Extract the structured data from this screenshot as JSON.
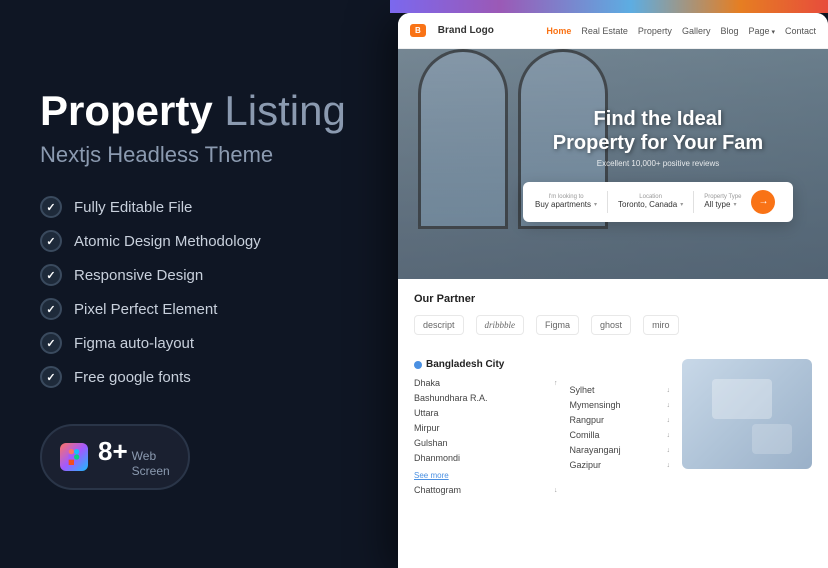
{
  "left": {
    "title_bold": "Property",
    "title_light": " Listing",
    "subtitle": "Nextjs Headless Theme",
    "features": [
      "Fully Editable File",
      "Atomic Design Methodology",
      "Responsive Design",
      "Pixel Perfect Element",
      "Figma auto-layout",
      "Free google fonts"
    ],
    "badge": {
      "number": "8+",
      "label_line1": "Web",
      "label_line2": "Screen"
    }
  },
  "browser": {
    "brand_box": "B",
    "brand_name": "Brand Logo",
    "nav_links": [
      {
        "label": "Home",
        "active": true
      },
      {
        "label": "Real Estate"
      },
      {
        "label": "Property"
      },
      {
        "label": "Gallery"
      },
      {
        "label": "Blog"
      },
      {
        "label": "Page",
        "has_arrow": true
      },
      {
        "label": "Contact"
      }
    ],
    "hero": {
      "title": "Find the Ideal\nProperty for Your Fam",
      "subtitle": "Excellent 10,000+ positive reviews",
      "search": {
        "field1_label": "I'm looking to",
        "field1_value": "Buy apartments",
        "field2_label": "Location",
        "field2_value": "Toronto, Canada",
        "field3_label": "Property Type",
        "field3_value": "All type"
      }
    },
    "partners": {
      "title": "Our Partner",
      "logos": [
        "descript",
        "dribbble",
        "Figma",
        "ghost",
        "miro"
      ]
    },
    "city": {
      "header": "Bangladesh City",
      "left_col": [
        {
          "name": "Dhaka",
          "arrow": "↑"
        },
        {
          "name": "Bashundhara R.A."
        },
        {
          "name": "Uttara"
        },
        {
          "name": "Mirpur"
        },
        {
          "name": "Gulshan"
        },
        {
          "name": "Dhanmondi"
        },
        {
          "name": "See more"
        },
        {
          "name": "Chattogram",
          "arrow": "↓"
        }
      ],
      "right_col": [
        {
          "name": "Sylhet",
          "arrow": "↓"
        },
        {
          "name": "Mymensingh",
          "arrow": "↓"
        },
        {
          "name": "Rangpur",
          "arrow": "↓"
        },
        {
          "name": "Comilla",
          "arrow": "↓"
        },
        {
          "name": "Narayanganj",
          "arrow": "↓"
        },
        {
          "name": "Gazipur",
          "arrow": "↓"
        }
      ]
    }
  }
}
